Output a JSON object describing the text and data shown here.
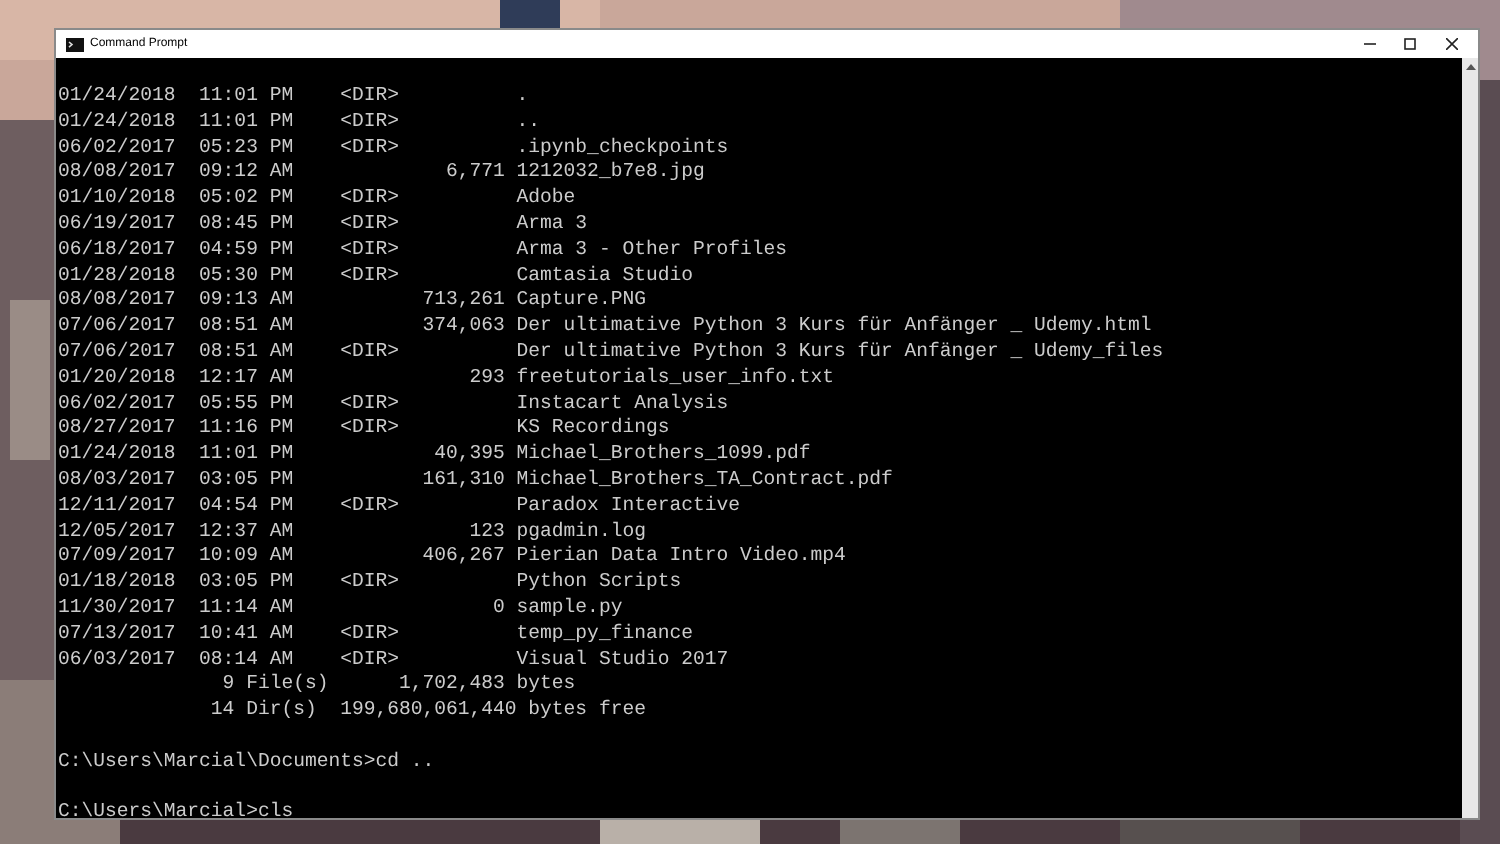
{
  "window": {
    "title": "Command Prompt"
  },
  "console": {
    "blocks": [
      [
        "01/24/2018  11:01 PM    <DIR>          .",
        "01/24/2018  11:01 PM    <DIR>          ..",
        "06/02/2017  05:23 PM    <DIR>          .ipynb_checkpoints",
        "08/08/2017  09:12 AM             6,771 1212032_b7e8.jpg",
        "01/10/2018  05:02 PM    <DIR>          Adobe",
        "06/19/2017  08:45 PM    <DIR>          Arma 3",
        "06/18/2017  04:59 PM    <DIR>          Arma 3 - Other Profiles",
        "01/28/2018  05:30 PM    <DIR>          Camtasia Studio",
        "08/08/2017  09:13 AM           713,261 Capture.PNG",
        "07/06/2017  08:51 AM           374,063 Der ultimative Python 3 Kurs für Anfänger _ Udemy.html",
        "07/06/2017  08:51 AM    <DIR>          Der ultimative Python 3 Kurs für Anfänger _ Udemy_files",
        "01/20/2018  12:17 AM               293 freetutorials_user_info.txt",
        "06/02/2017  05:55 PM    <DIR>          Instacart Analysis",
        "08/27/2017  11:16 PM    <DIR>          KS Recordings",
        "01/24/2018  11:01 PM            40,395 Michael_Brothers_1099.pdf",
        "08/03/2017  03:05 PM           161,310 Michael_Brothers_TA_Contract.pdf",
        "12/11/2017  04:54 PM    <DIR>          Paradox Interactive",
        "12/05/2017  12:37 AM               123 pgadmin.log",
        "07/09/2017  10:09 AM           406,267 Pierian Data Intro Video.mp4",
        "01/18/2018  03:05 PM    <DIR>          Python Scripts",
        "11/30/2017  11:14 AM                 0 sample.py",
        "07/13/2017  10:41 AM    <DIR>          temp_py_finance",
        "06/03/2017  08:14 AM    <DIR>          Visual Studio 2017",
        "              9 File(s)      1,702,483 bytes",
        "             14 Dir(s)  199,680,061,440 bytes free"
      ],
      [
        "C:\\Users\\Marcial\\Documents>cd .."
      ],
      [
        "C:\\Users\\Marcial>cls"
      ]
    ]
  }
}
